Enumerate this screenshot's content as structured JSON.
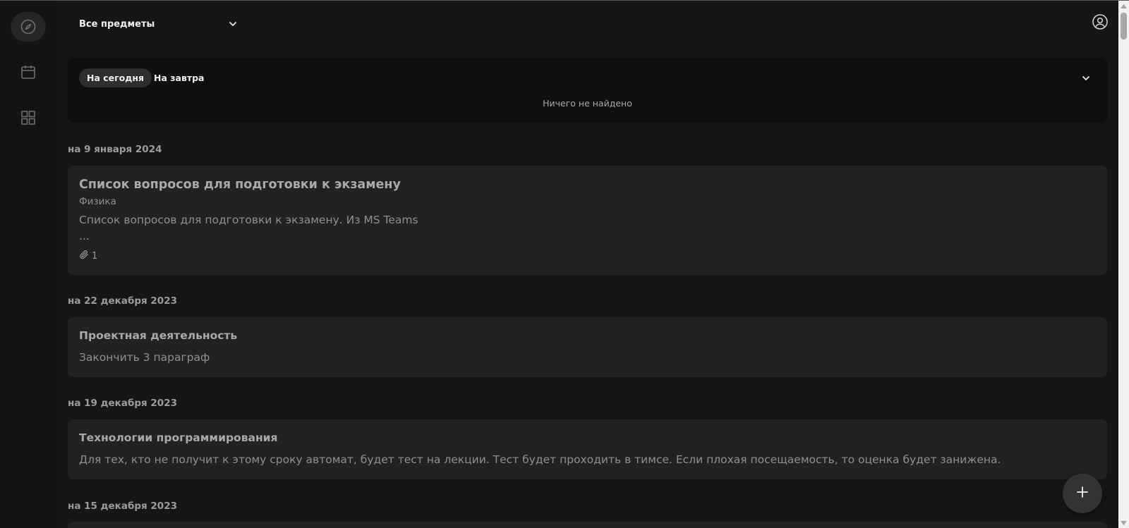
{
  "rail": {
    "items": [
      {
        "icon": "compass-icon",
        "active": true
      },
      {
        "icon": "calendar-icon",
        "active": false
      },
      {
        "icon": "grid-icon",
        "active": false
      }
    ]
  },
  "header": {
    "subject_filter": "Все предметы"
  },
  "today_panel": {
    "tabs": [
      {
        "label": "На сегодня",
        "active": true
      },
      {
        "label": "На завтра",
        "active": false
      }
    ],
    "empty_message": "Ничего не найдено"
  },
  "groups": [
    {
      "date": "на 9 января 2024",
      "cards": [
        {
          "title": "Список вопросов для подготовки к экзамену",
          "subject": "Физика",
          "text": "Список вопросов для подготовки к экзамену. Из MS Teams",
          "ellipsis": "...",
          "attachments": "1"
        }
      ]
    },
    {
      "date": "на 22 декабря 2023",
      "cards": [
        {
          "title": "Проектная деятельность",
          "text": "Закончить 3 параграф"
        }
      ]
    },
    {
      "date": "на 19 декабря 2023",
      "cards": [
        {
          "title": "Технологии программирования",
          "text": "Для тех, кто не получит к этому сроку автомат, будет тест на лекции. Тест будет проходить в тимсе. Если плохая посещаемость, то оценка будет занижена."
        }
      ]
    },
    {
      "date": "на 15 декабря 2023",
      "cards": []
    }
  ],
  "fab": {
    "icon": "plus-icon"
  },
  "colors": {
    "background": "#161616",
    "rail": "#141414",
    "panel": "#0f0f0f",
    "card": "#222222",
    "active_pill": "#2e2e2e"
  }
}
